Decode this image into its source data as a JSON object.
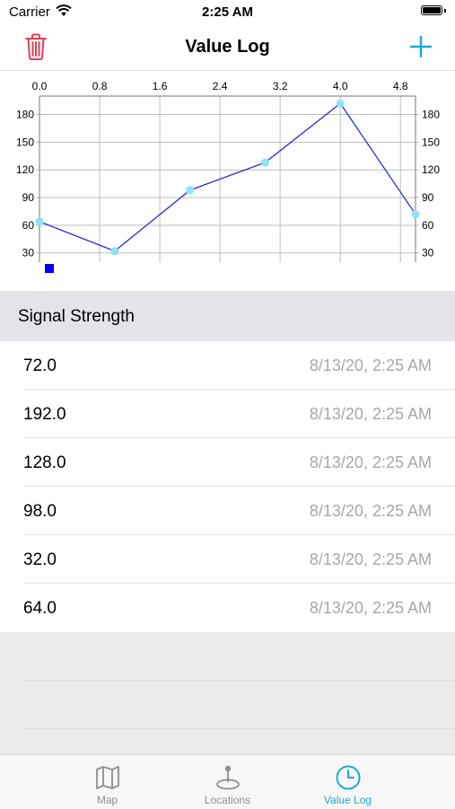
{
  "status_bar": {
    "carrier": "Carrier",
    "time": "2:25 AM"
  },
  "nav": {
    "title": "Value Log",
    "left_icon": "trash-icon",
    "right_icon": "plus-icon"
  },
  "colors": {
    "accent": "#1aa9d6",
    "delete": "#e0405a",
    "line": "#2a2ad8",
    "point": "#8ee4f5",
    "legend": "#0000ee"
  },
  "chart_data": {
    "type": "line",
    "title": "",
    "xlabel": "",
    "ylabel": "",
    "x_ticks": [
      "0.0",
      "0.8",
      "1.6",
      "2.4",
      "3.2",
      "4.0",
      "4.8"
    ],
    "y_ticks_left": [
      "180",
      "150",
      "120",
      "90",
      "60",
      "30"
    ],
    "y_ticks_right": [
      "180",
      "150",
      "120",
      "90",
      "60",
      "30"
    ],
    "xlim": [
      0,
      5
    ],
    "ylim": [
      20,
      200
    ],
    "grid": true,
    "series": [
      {
        "x": [
          0,
          1,
          2,
          3,
          4,
          5
        ],
        "values": [
          64,
          32,
          98,
          128,
          192,
          72
        ]
      }
    ]
  },
  "table": {
    "section_header": "Signal Strength",
    "rows": [
      {
        "value": "72.0",
        "date": "8/13/20, 2:25 AM"
      },
      {
        "value": "192.0",
        "date": "8/13/20, 2:25 AM"
      },
      {
        "value": "128.0",
        "date": "8/13/20, 2:25 AM"
      },
      {
        "value": "98.0",
        "date": "8/13/20, 2:25 AM"
      },
      {
        "value": "32.0",
        "date": "8/13/20, 2:25 AM"
      },
      {
        "value": "64.0",
        "date": "8/13/20, 2:25 AM"
      }
    ]
  },
  "tab_bar": {
    "tabs": [
      {
        "label": "Map",
        "icon": "map-icon",
        "active": false
      },
      {
        "label": "Locations",
        "icon": "location-pin-icon",
        "active": false
      },
      {
        "label": "Value Log",
        "icon": "clock-icon",
        "active": true
      }
    ]
  }
}
